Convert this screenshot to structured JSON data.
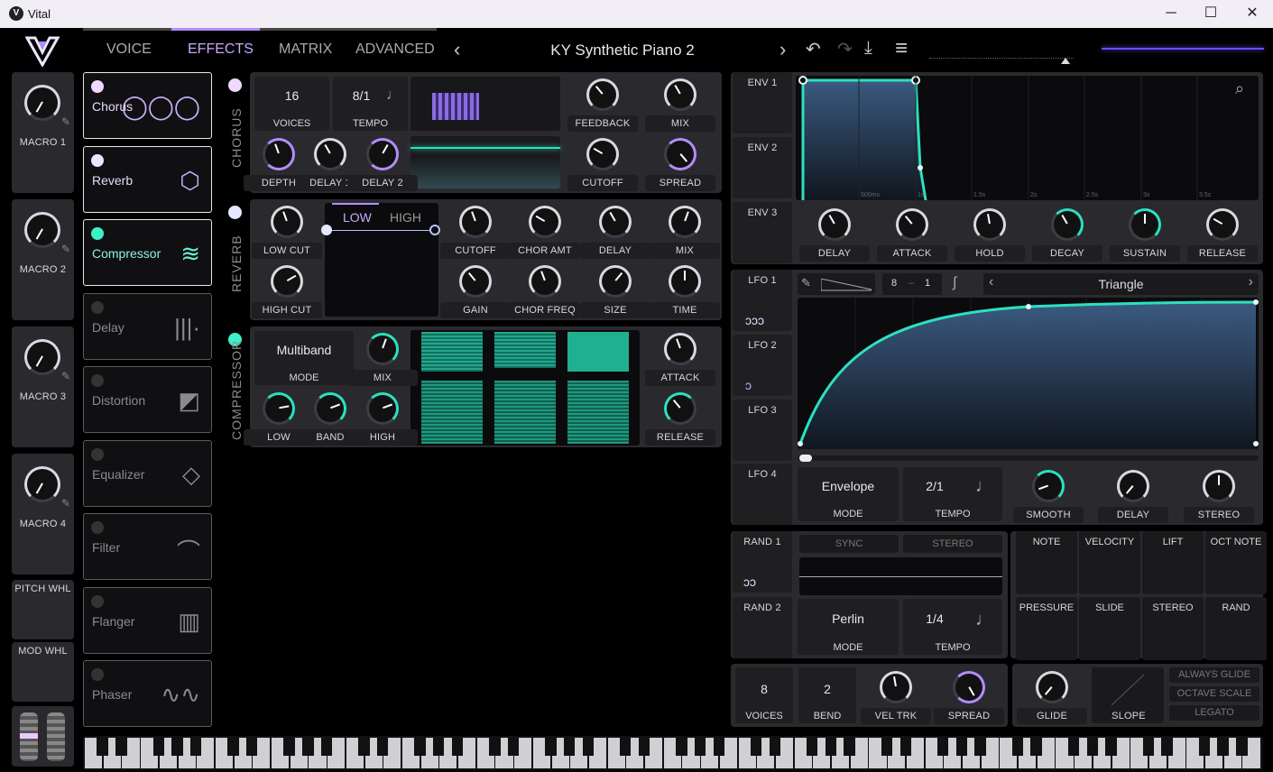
{
  "window": {
    "title": "Vital",
    "logo_letter": "V",
    "minimize": "─",
    "maximize": "☐",
    "close": "✕"
  },
  "header": {
    "tabs": [
      "VOICE",
      "EFFECTS",
      "MATRIX",
      "ADVANCED"
    ],
    "active_tab": "EFFECTS",
    "preset_name": "KY Synthetic Piano 2",
    "prev": "‹",
    "next": "›",
    "undo": "↶",
    "redo": "↷",
    "save": "⤓",
    "menu": "≡"
  },
  "macros": [
    "MACRO 1",
    "MACRO 2",
    "MACRO 3",
    "MACRO 4"
  ],
  "wheels": {
    "pitch": "PITCH WHL",
    "mod": "MOD WHL"
  },
  "effects_list": [
    {
      "name": "Chorus",
      "on": true,
      "icon": "chorus-icon",
      "glyph": "◯◯◯"
    },
    {
      "name": "Reverb",
      "on": true,
      "icon": "reverb-icon",
      "glyph": "⬡"
    },
    {
      "name": "Compressor",
      "on": true,
      "icon": "compressor-icon",
      "glyph": "≋"
    },
    {
      "name": "Delay",
      "on": false,
      "icon": "delay-icon",
      "glyph": "|||·"
    },
    {
      "name": "Distortion",
      "on": false,
      "icon": "distortion-icon",
      "glyph": "◩"
    },
    {
      "name": "Equalizer",
      "on": false,
      "icon": "equalizer-icon",
      "glyph": "◇"
    },
    {
      "name": "Filter",
      "on": false,
      "icon": "filter-icon",
      "glyph": "⌒"
    },
    {
      "name": "Flanger",
      "on": false,
      "icon": "flanger-icon",
      "glyph": "▥"
    },
    {
      "name": "Phaser",
      "on": false,
      "icon": "phaser-icon",
      "glyph": "∿∿"
    }
  ],
  "chorus": {
    "section": "CHORUS",
    "voices": "16",
    "voices_label": "VOICES",
    "tempo": "8/1",
    "tempo_label": "TEMPO",
    "note": "♩",
    "knobs": [
      "FEEDBACK",
      "MIX",
      "DEPTH",
      "DELAY 1",
      "DELAY 2",
      "CUTOFF",
      "SPREAD"
    ]
  },
  "reverb": {
    "section": "REVERB",
    "tab_low": "LOW",
    "tab_high": "HIGH",
    "knobs": [
      "LOW CUT",
      "HIGH CUT",
      "CUTOFF",
      "CHOR AMT",
      "DELAY",
      "MIX",
      "GAIN",
      "CHOR FREQ",
      "SIZE",
      "TIME"
    ]
  },
  "compressor": {
    "section": "COMPRESSOR",
    "mode": "Multiband",
    "mode_label": "MODE",
    "knobs": [
      "MIX",
      "LOW",
      "BAND",
      "HIGH",
      "ATTACK",
      "RELEASE"
    ]
  },
  "envelopes": {
    "tabs": [
      "ENV 1",
      "ENV 2",
      "ENV 3"
    ],
    "time_marks": [
      "500ms",
      "1s",
      "1.5s",
      "2s",
      "2.5s",
      "3s",
      "3.5s"
    ],
    "knobs": [
      "DELAY",
      "ATTACK",
      "HOLD",
      "DECAY",
      "SUSTAIN",
      "RELEASE"
    ]
  },
  "lfos": {
    "tabs": [
      "LFO 1",
      "LFO 2",
      "LFO 3",
      "LFO 4"
    ],
    "grid_x": "8",
    "grid_sep": "–",
    "grid_y": "1",
    "shape": "Triangle",
    "mode": "Envelope",
    "mode_label": "MODE",
    "tempo": "2/1",
    "tempo_label": "TEMPO",
    "note": "♩",
    "knobs": [
      "SMOOTH",
      "DELAY",
      "STEREO"
    ]
  },
  "random": {
    "tabs": [
      "RAND 1",
      "RAND 2"
    ],
    "sync": "SYNC",
    "stereo": "STEREO",
    "mode": "Perlin",
    "mode_label": "MODE",
    "tempo": "1/4",
    "tempo_label": "TEMPO",
    "note": "♩"
  },
  "mod_sources": [
    "NOTE",
    "VELOCITY",
    "LIFT",
    "OCT NOTE",
    "PRESSURE",
    "SLIDE",
    "STEREO",
    "RAND"
  ],
  "voice": {
    "voices": "8",
    "voices_label": "VOICES",
    "bend": "2",
    "bend_label": "BEND",
    "knobs": [
      "VEL TRK",
      "SPREAD"
    ]
  },
  "glide": {
    "knobs": [
      "GLIDE",
      "SLOPE"
    ],
    "buttons": [
      "ALWAYS GLIDE",
      "OCTAVE SCALE",
      "LEGATO"
    ]
  },
  "colors": {
    "accent_purple": "#b48cff",
    "accent_teal": "#2ce0c0",
    "panel": "#2a2a2e"
  }
}
